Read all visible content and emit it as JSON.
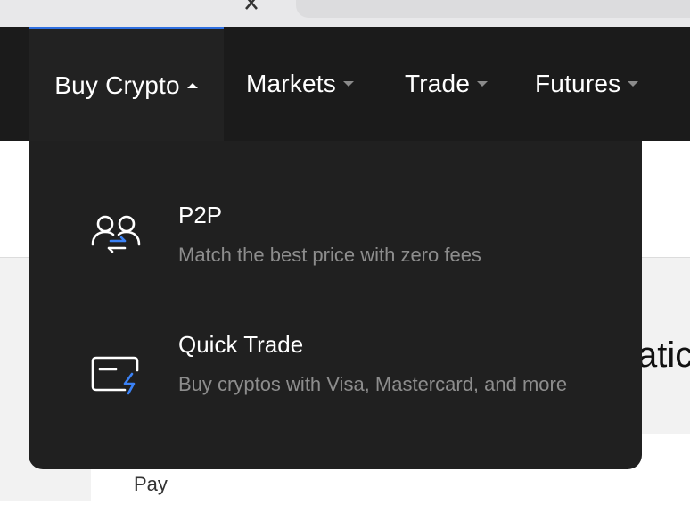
{
  "nav": {
    "items": [
      {
        "label": "Buy Crypto",
        "active": true,
        "caret": "caret-up-icon"
      },
      {
        "label": "Markets",
        "active": false,
        "caret": "caret-down-icon"
      },
      {
        "label": "Trade",
        "active": false,
        "caret": "caret-down-icon"
      },
      {
        "label": "Futures",
        "active": false,
        "caret": "caret-down-icon"
      }
    ]
  },
  "dropdown": {
    "items": [
      {
        "title": "P2P",
        "description": "Match the best price with zero fees",
        "icon": "p2p-users-icon"
      },
      {
        "title": "Quick Trade",
        "description": "Buy cryptos with Visa, Mastercard, and more",
        "icon": "card-lightning-icon"
      }
    ]
  },
  "page": {
    "headline_fragment": "atic",
    "pay_label": "Pay"
  },
  "colors": {
    "nav_bg": "#1b1b1b",
    "dropdown_bg": "#202020",
    "accent": "#2f6fe0",
    "muted_text": "#8d8d8d"
  }
}
